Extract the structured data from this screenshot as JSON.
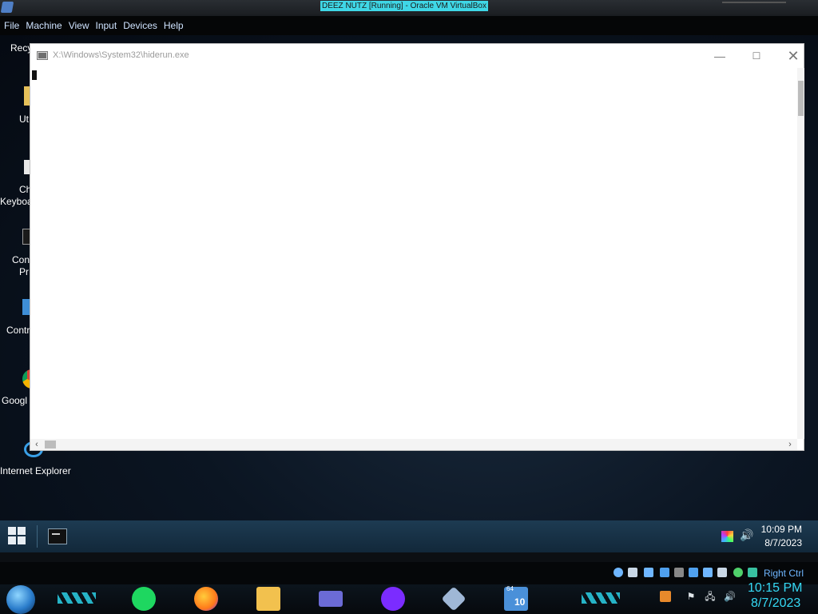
{
  "vbox": {
    "title": "DEEZ NUTZ [Running] - Oracle VM VirtualBox",
    "menu": [
      "File",
      "Machine",
      "View",
      "Input",
      "Devices",
      "Help"
    ],
    "host_key": "Right Ctrl"
  },
  "desktop": {
    "icons": [
      {
        "label": "Recy"
      },
      {
        "label": "Ut"
      },
      {
        "label": "Ch"
      },
      {
        "label": "Keyboa"
      },
      {
        "label": "Con"
      },
      {
        "label": "Pr"
      },
      {
        "label": "Contr"
      },
      {
        "label": "Googl"
      },
      {
        "label": "Internet Explorer"
      }
    ]
  },
  "console": {
    "title": "X:\\Windows\\System32\\hiderun.exe",
    "min_glyph": "—",
    "max_glyph": "☐",
    "close_glyph": "✕",
    "scroll_left": "‹",
    "scroll_right": "›"
  },
  "guest_taskbar": {
    "time": "10:09 PM",
    "date": "8/7/2023",
    "volume_glyph": "🔊"
  },
  "host_taskbar": {
    "time": "10:15 PM",
    "date": "8/7/2023",
    "apps": [
      {
        "icon": "spotify-icon",
        "color": "#1ed760"
      },
      {
        "icon": "firefox-icon",
        "color": "#ff7a1a"
      },
      {
        "icon": "file-explorer-icon",
        "color": "#f2c14e"
      },
      {
        "icon": "media-player-icon",
        "color": "#6b6bd6"
      },
      {
        "icon": "privacy-mask-icon",
        "color": "#7b2cff"
      },
      {
        "icon": "virtualbox-icon",
        "color": "#9fb7d6"
      },
      {
        "icon": "windows-10-icon",
        "color": "#4a90d9"
      }
    ],
    "tray_badge": "10",
    "tray_badge_top": "64"
  },
  "colors": {
    "accent": "#35d9f4",
    "vbox_title_highlight": "#3fd7e6"
  }
}
